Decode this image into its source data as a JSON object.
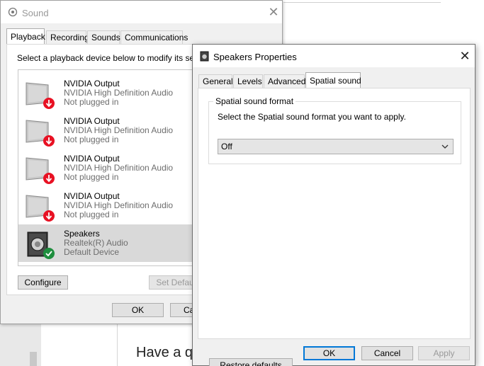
{
  "background": {
    "page_text": "Have a qu"
  },
  "sound_window": {
    "title": "Sound",
    "tabs": [
      "Playback",
      "Recording",
      "Sounds",
      "Communications"
    ],
    "instruction": "Select a playback device below to modify its setti",
    "devices": [
      {
        "name": "NVIDIA Output",
        "driver": "NVIDIA High Definition Audio",
        "status": "Not plugged in",
        "icon": "monitor-icon"
      },
      {
        "name": "NVIDIA Output",
        "driver": "NVIDIA High Definition Audio",
        "status": "Not plugged in",
        "icon": "monitor-icon"
      },
      {
        "name": "NVIDIA Output",
        "driver": "NVIDIA High Definition Audio",
        "status": "Not plugged in",
        "icon": "monitor-icon"
      },
      {
        "name": "NVIDIA Output",
        "driver": "NVIDIA High Definition Audio",
        "status": "Not plugged in",
        "icon": "monitor-icon"
      },
      {
        "name": "Speakers",
        "driver": "Realtek(R) Audio",
        "status": "Default Device",
        "icon": "speaker-icon"
      }
    ],
    "buttons": {
      "configure": "Configure",
      "set_default": "Set Default",
      "ok": "OK",
      "cancel": "Ca"
    }
  },
  "props_window": {
    "title": "Speakers Properties",
    "tabs": [
      "General",
      "Levels",
      "Advanced",
      "Spatial sound"
    ],
    "group_title": "Spatial sound format",
    "group_desc": "Select the Spatial sound format you want to apply.",
    "format_value": "Off",
    "buttons": {
      "restore": "Restore defaults",
      "ok": "OK",
      "cancel": "Cancel",
      "apply": "Apply"
    }
  },
  "colors": {
    "status_ok": "#1e8e3e",
    "status_error": "#e81123",
    "focus_blue": "#0078d7",
    "selected_row": "#d9d9d9"
  }
}
